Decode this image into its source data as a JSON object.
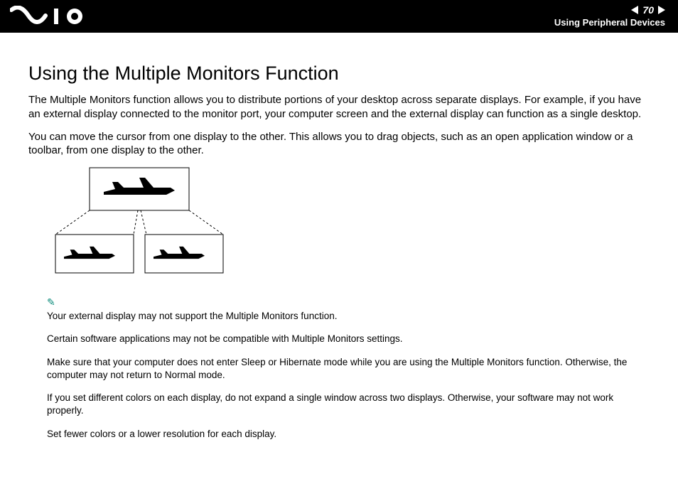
{
  "header": {
    "page_number": "70",
    "section": "Using Peripheral Devices"
  },
  "title": "Using the Multiple Monitors Function",
  "paragraphs": {
    "p1": "The Multiple Monitors function allows you to distribute portions of your desktop across separate displays. For example, if you have an external display connected to the monitor port, your computer screen and the external display can function as a single desktop.",
    "p2": "You can move the cursor from one display to the other. This allows you to drag objects, such as an open application window or a toolbar, from one display to the other."
  },
  "notes": {
    "n1": "Your external display may not support the Multiple Monitors function.",
    "n2": "Certain software applications may not be compatible with Multiple Monitors settings.",
    "n3": "Make sure that your computer does not enter Sleep or Hibernate mode while you are using the Multiple Monitors function. Otherwise, the computer may not return to Normal mode.",
    "n4": "If you set different colors on each display, do not expand a single window across two displays. Otherwise, your software may not work properly.",
    "n5": "Set fewer colors or a lower resolution for each display."
  }
}
